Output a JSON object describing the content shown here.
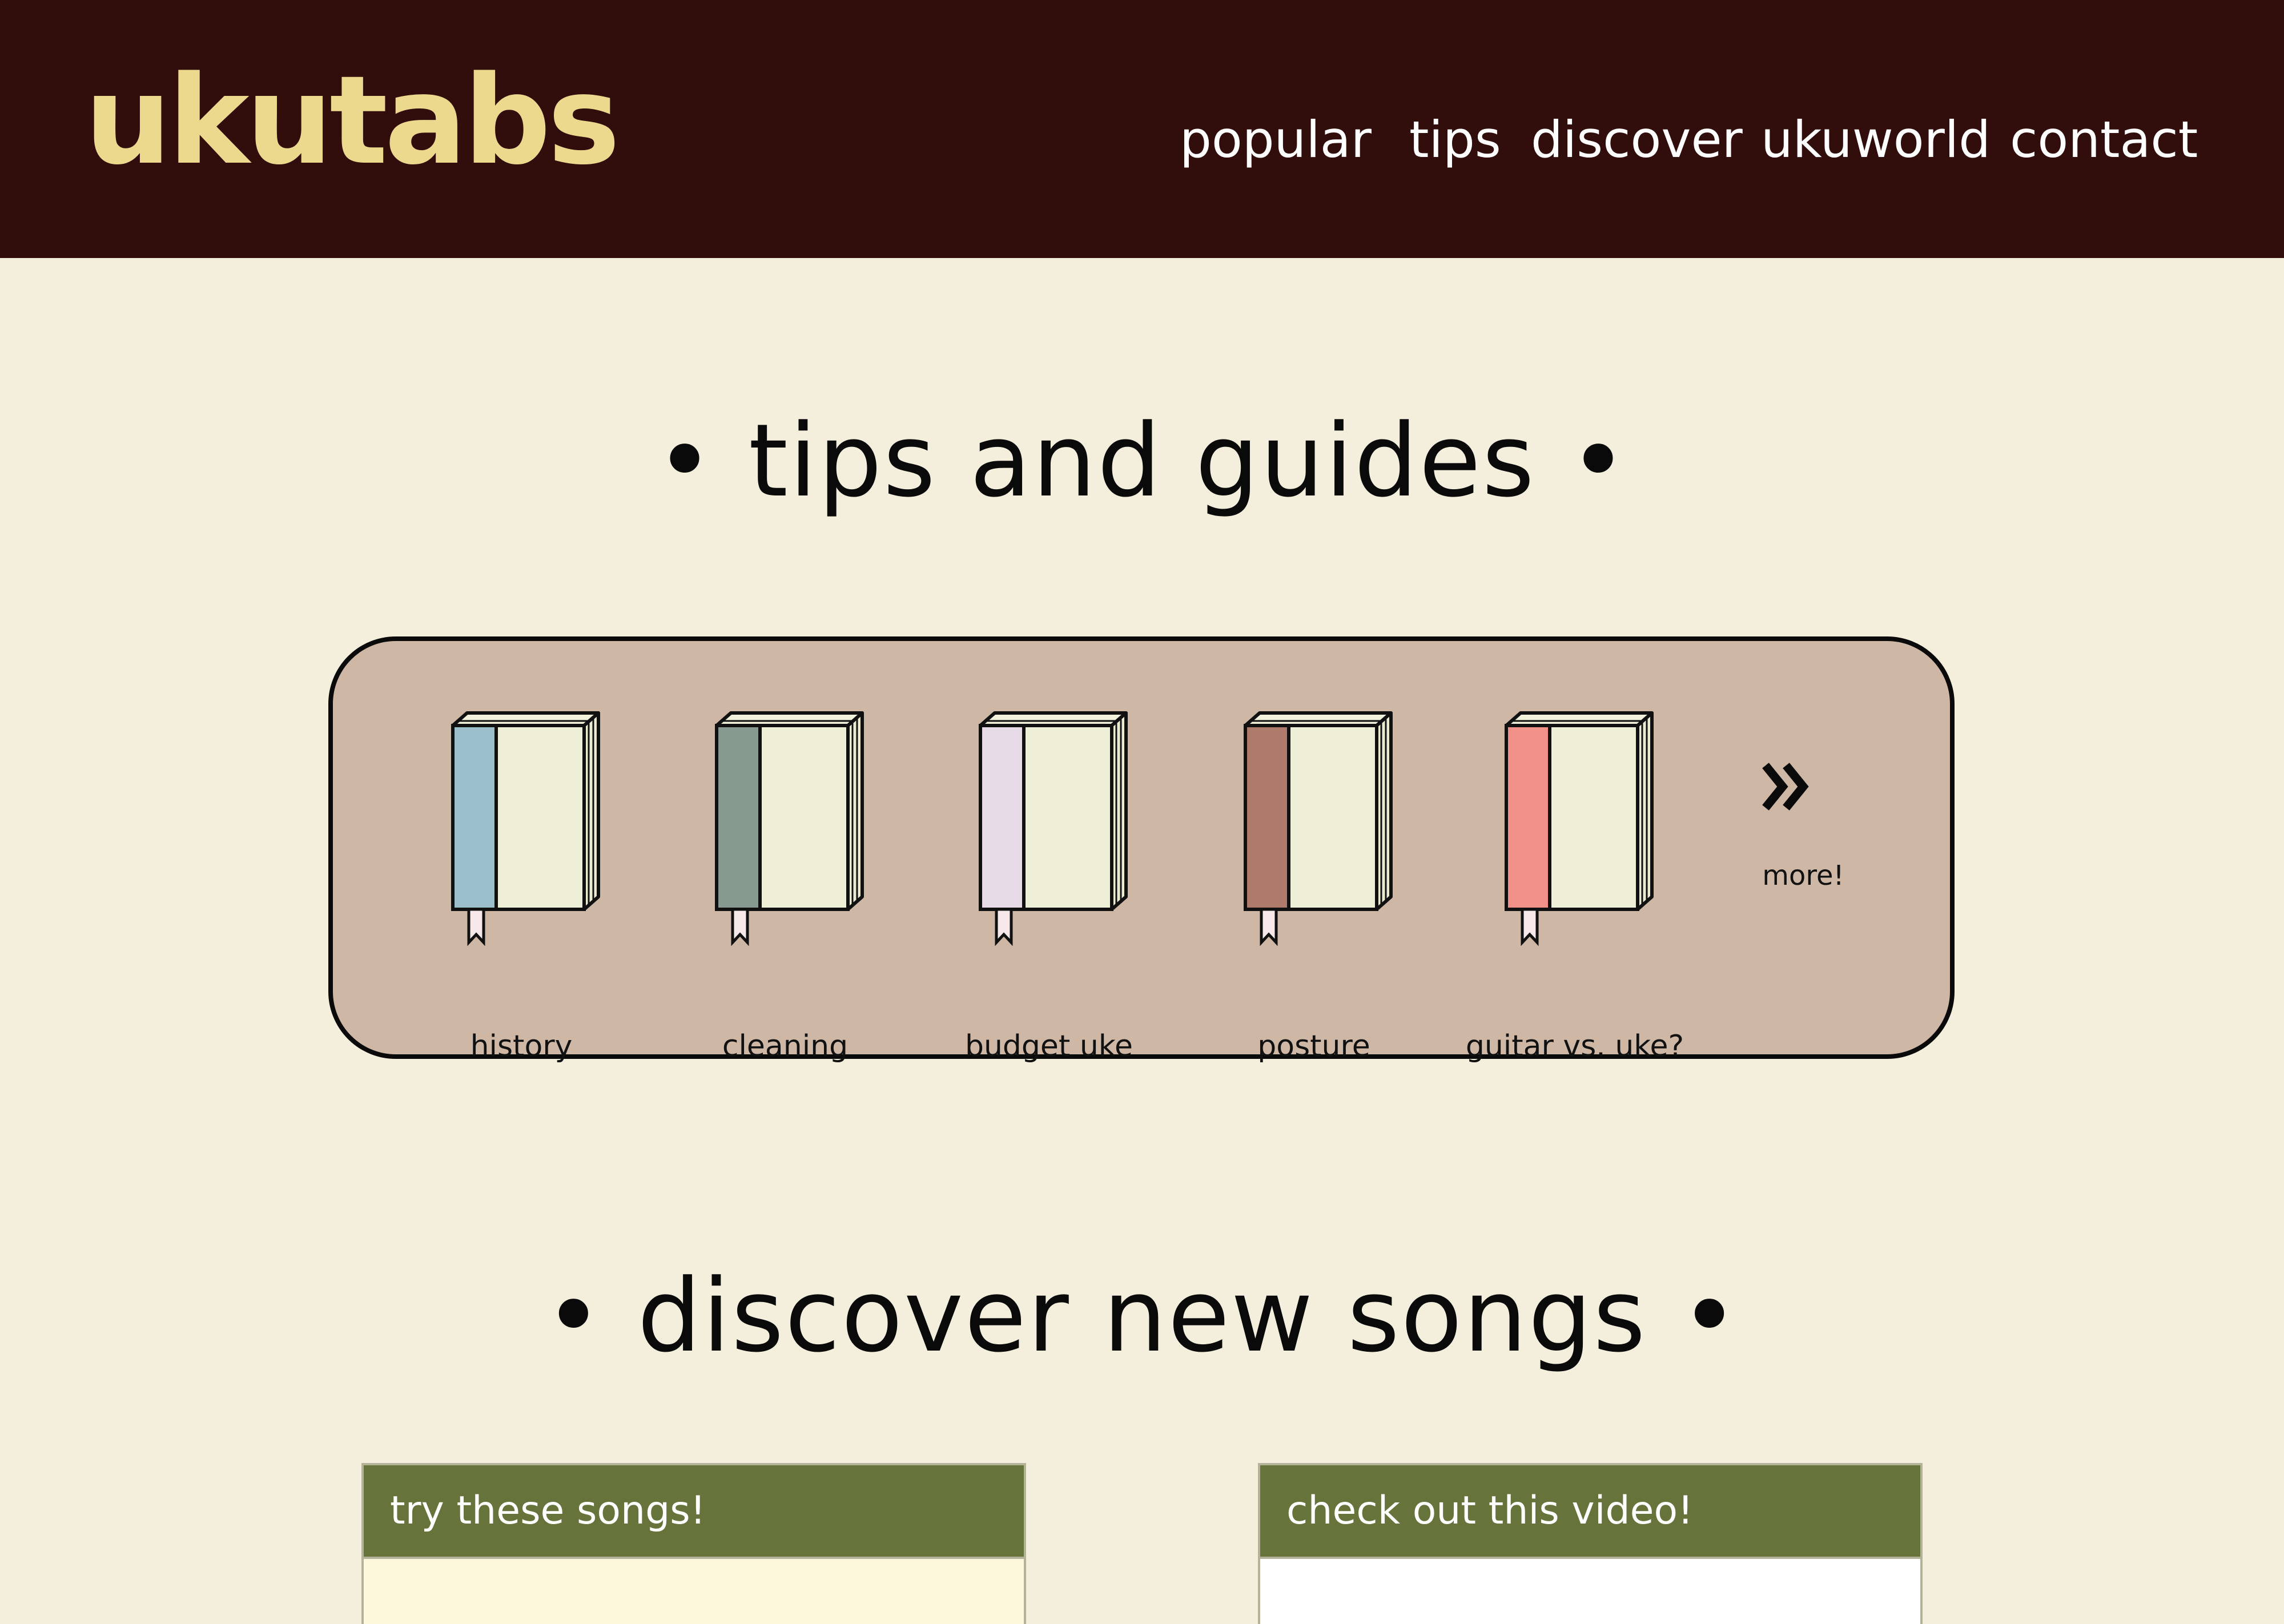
{
  "header": {
    "logo": "ukutabs",
    "nav": [
      "popular",
      "tips",
      "discover",
      "ukuworld",
      "contact"
    ]
  },
  "tips_section": {
    "title": "• tips and guides •",
    "books": [
      {
        "label": "history",
        "spine_color": "#9bc0cb"
      },
      {
        "label": "cleaning",
        "spine_color": "#869a90"
      },
      {
        "label": "budget uke",
        "spine_color": "#e8dbe8"
      },
      {
        "label": "posture",
        "spine_color": "#ad7a6c"
      },
      {
        "label": "guitar vs. uke?",
        "spine_color": "#f2908a"
      }
    ],
    "more_label": "more!",
    "more_icon": "double-chevron-right-icon"
  },
  "discover_section": {
    "title": "• discover new songs •",
    "songs_card_title": "try these songs!",
    "video_card_title": "check out this video!"
  },
  "colors": {
    "header_bg": "#310e0c",
    "logo": "#ecd98e",
    "page_bg": "#f4efdc",
    "panel_bg": "#cfb7a5",
    "card_header": "#66733a",
    "songs_card_body": "#fdf8db",
    "video_card_body": "#ffffff"
  }
}
